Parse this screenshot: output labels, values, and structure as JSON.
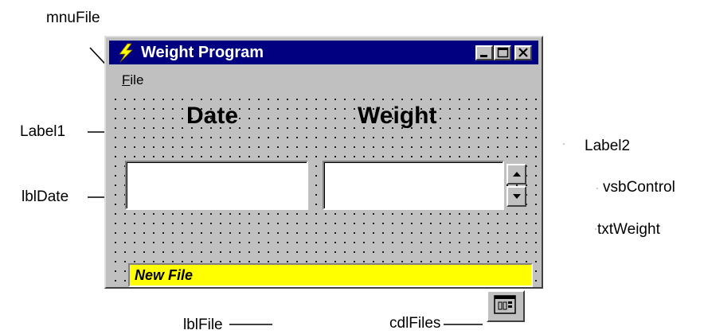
{
  "callouts": {
    "mnuFile": "mnuFile",
    "label1": "Label1",
    "lblDate": "lblDate",
    "label2": "Label2",
    "vsbControl": "vsbControl",
    "txtWeight": "txtWeight",
    "lblFile": "lblFile",
    "cdlFiles": "cdlFiles"
  },
  "window": {
    "title": "Weight Program",
    "menu": {
      "file_label_rest": "ile",
      "file_accel": "F"
    }
  },
  "form": {
    "label1_text": "Date",
    "label2_text": "Weight",
    "lblFile_text": "New File"
  },
  "colors": {
    "titlebar": "#000080",
    "form_bg": "#c0c0c0",
    "lblFile_bg": "#ffff00"
  },
  "icons": [
    "lightning-icon",
    "minimize-icon",
    "maximize-icon",
    "close-icon",
    "arrow-up-icon",
    "arrow-down-icon",
    "common-dialog-icon"
  ]
}
